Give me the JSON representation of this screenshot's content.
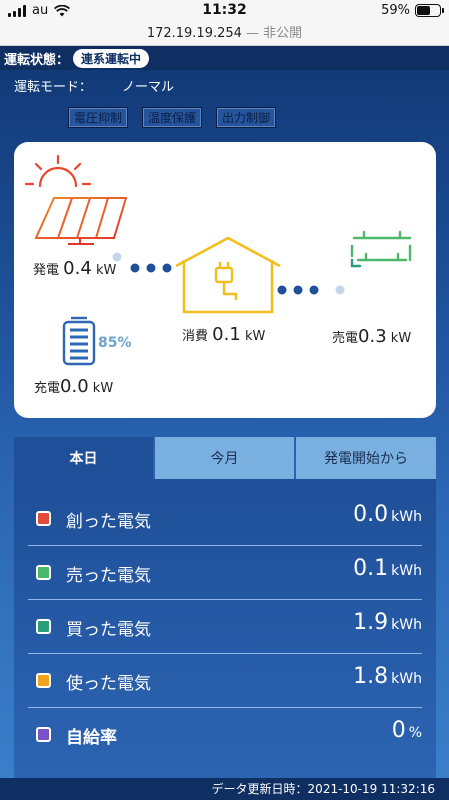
{
  "status_bar": {
    "carrier": "au",
    "time": "11:32",
    "battery": "59%",
    "battery_level": 0.59
  },
  "url_bar": {
    "address": "172.19.19.254",
    "suffix": " — 非公開"
  },
  "header": {
    "state_label": "運転状態：",
    "state_value": "連系運転中",
    "mode_label": "運転モード：",
    "mode_value": "ノーマル",
    "buttons": [
      "電圧抑制",
      "温度保護",
      "出力制御"
    ]
  },
  "flow": {
    "generation": {
      "label": "発電",
      "value": "0.4",
      "unit": "kW"
    },
    "consumption": {
      "label": "消費",
      "value": "0.1",
      "unit": "kW"
    },
    "sell": {
      "label": "売電",
      "value": "0.3",
      "unit": "kW"
    },
    "charge": {
      "label": "充電",
      "value": "0.0",
      "unit": "kW"
    },
    "battery_percent": "85%",
    "icons": [
      "sun-icon",
      "solar-panel-icon",
      "house-icon",
      "plug-icon",
      "utility-pole-icon",
      "battery-icon"
    ],
    "colors": {
      "solar": "#e8472c",
      "house": "#f2bf1f",
      "grid": "#3ea76a",
      "battery": "#2e67b3",
      "flow_dot": "#1f4f98"
    }
  },
  "tabs": [
    "本日",
    "今月",
    "発電開始から"
  ],
  "stats": [
    {
      "label": "創った電気",
      "value": "0.0",
      "unit": "kWh",
      "color": "#e14b3b"
    },
    {
      "label": "売った電気",
      "value": "0.1",
      "unit": "kWh",
      "color": "#4cb86c"
    },
    {
      "label": "買った電気",
      "value": "1.9",
      "unit": "kWh",
      "color": "#2a9d7a"
    },
    {
      "label": "使った電気",
      "value": "1.8",
      "unit": "kWh",
      "color": "#f0a21e"
    },
    {
      "label": "自給率",
      "value": "0",
      "unit": "%",
      "color": "#7b52c7"
    }
  ],
  "footer": {
    "label": "データ更新日時：",
    "datetime": "2021-10-19 11:32:16"
  }
}
